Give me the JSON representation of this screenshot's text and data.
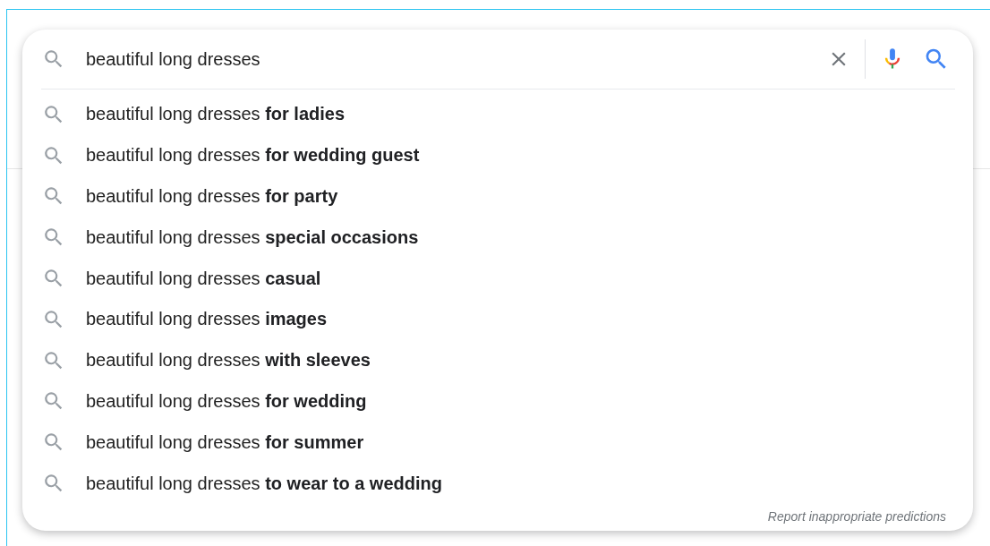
{
  "search": {
    "value": "beautiful long dresses"
  },
  "suggestions": [
    {
      "text": "beautiful long dresses **for ladies**"
    },
    {
      "text": "beautiful long dresses **for wedding guest**"
    },
    {
      "text": "beautiful long dresses **for party**"
    },
    {
      "text": "beautiful long dresses **special occasions**"
    },
    {
      "text": "beautiful long dresses **casual**"
    },
    {
      "text": "beautiful long dresses **images**"
    },
    {
      "text": "beautiful long dresses **with sleeves**"
    },
    {
      "text": "beautiful long dresses **for wedding**"
    },
    {
      "text": "beautiful long dresses **for summer**"
    },
    {
      "text": "beautiful long dresses **to wear to a wedding**"
    }
  ],
  "report_link": "Report inappropriate predictions"
}
